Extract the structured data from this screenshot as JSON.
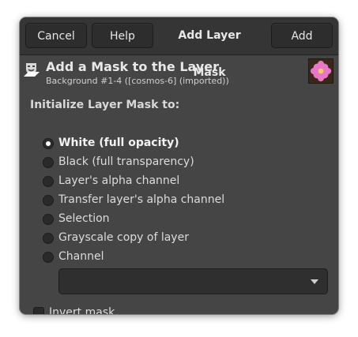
{
  "header": {
    "cancel_label": "Cancel",
    "help_label": "Help",
    "title": "Add Layer Mask",
    "add_label": "Add"
  },
  "layer": {
    "heading": "Add a Mask to the Layer",
    "subtitle": "Background #1-4 ([cosmos-6] (imported))",
    "thumbnail_icon": "cosmos-flower-thumbnail"
  },
  "init": {
    "label": "Initialize Layer Mask to:",
    "options": [
      {
        "label": "White (full opacity)",
        "selected": true
      },
      {
        "label": "Black (full transparency)",
        "selected": false
      },
      {
        "label": "Layer's alpha channel",
        "selected": false
      },
      {
        "label": "Transfer layer's alpha channel",
        "selected": false
      },
      {
        "label": "Selection",
        "selected": false
      },
      {
        "label": "Grayscale copy of layer",
        "selected": false
      },
      {
        "label": "Channel",
        "selected": false
      }
    ],
    "channel_value": ""
  },
  "invert": {
    "label": "Invert mask",
    "checked": false
  },
  "colors": {
    "dialog_bg": "#454545",
    "header_bg": "#353535",
    "text": "#e6e6e6"
  }
}
